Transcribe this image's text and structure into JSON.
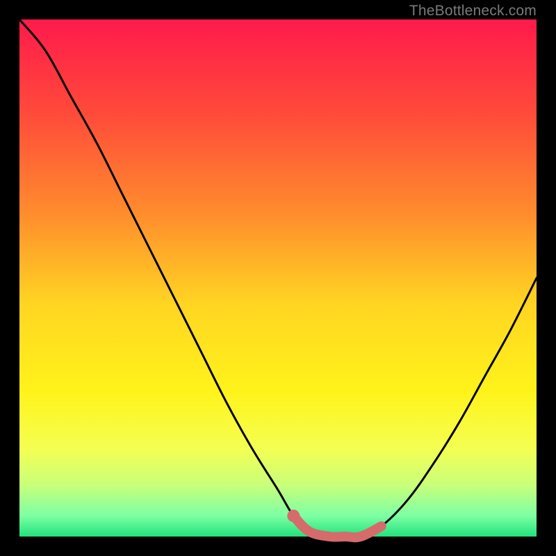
{
  "watermark": "TheBottleneck.com",
  "colors": {
    "background": "#000000",
    "curve": "#000000",
    "highlight": "#d66b6b",
    "watermark_text": "#7a7a7a",
    "gradient_stops": [
      {
        "offset": 0.0,
        "color": "#ff1a4b"
      },
      {
        "offset": 0.18,
        "color": "#ff4a3a"
      },
      {
        "offset": 0.38,
        "color": "#ff8e2d"
      },
      {
        "offset": 0.55,
        "color": "#ffd522"
      },
      {
        "offset": 0.72,
        "color": "#fff31a"
      },
      {
        "offset": 0.83,
        "color": "#f4ff52"
      },
      {
        "offset": 0.9,
        "color": "#c9ff7a"
      },
      {
        "offset": 0.96,
        "color": "#7dffa4"
      },
      {
        "offset": 1.0,
        "color": "#21e27d"
      }
    ]
  },
  "chart_data": {
    "type": "line",
    "title": "",
    "xlabel": "",
    "ylabel": "",
    "xlim": [
      0,
      100
    ],
    "ylim": [
      0,
      100
    ],
    "grid": false,
    "x": [
      0,
      5,
      10,
      15,
      20,
      25,
      30,
      35,
      40,
      45,
      50,
      53,
      56,
      60,
      63,
      66,
      70,
      75,
      80,
      85,
      90,
      95,
      100
    ],
    "series": [
      {
        "name": "curve",
        "values": [
          100,
          94,
          85,
          76,
          66,
          56,
          46,
          36,
          26,
          17,
          9,
          4,
          1,
          0,
          0,
          0,
          2,
          7,
          14,
          22,
          31,
          40,
          50
        ]
      }
    ],
    "highlight_segment": {
      "x": [
        53,
        56,
        60,
        63,
        66,
        70
      ],
      "values": [
        4,
        1,
        0,
        0,
        0,
        2
      ]
    }
  }
}
